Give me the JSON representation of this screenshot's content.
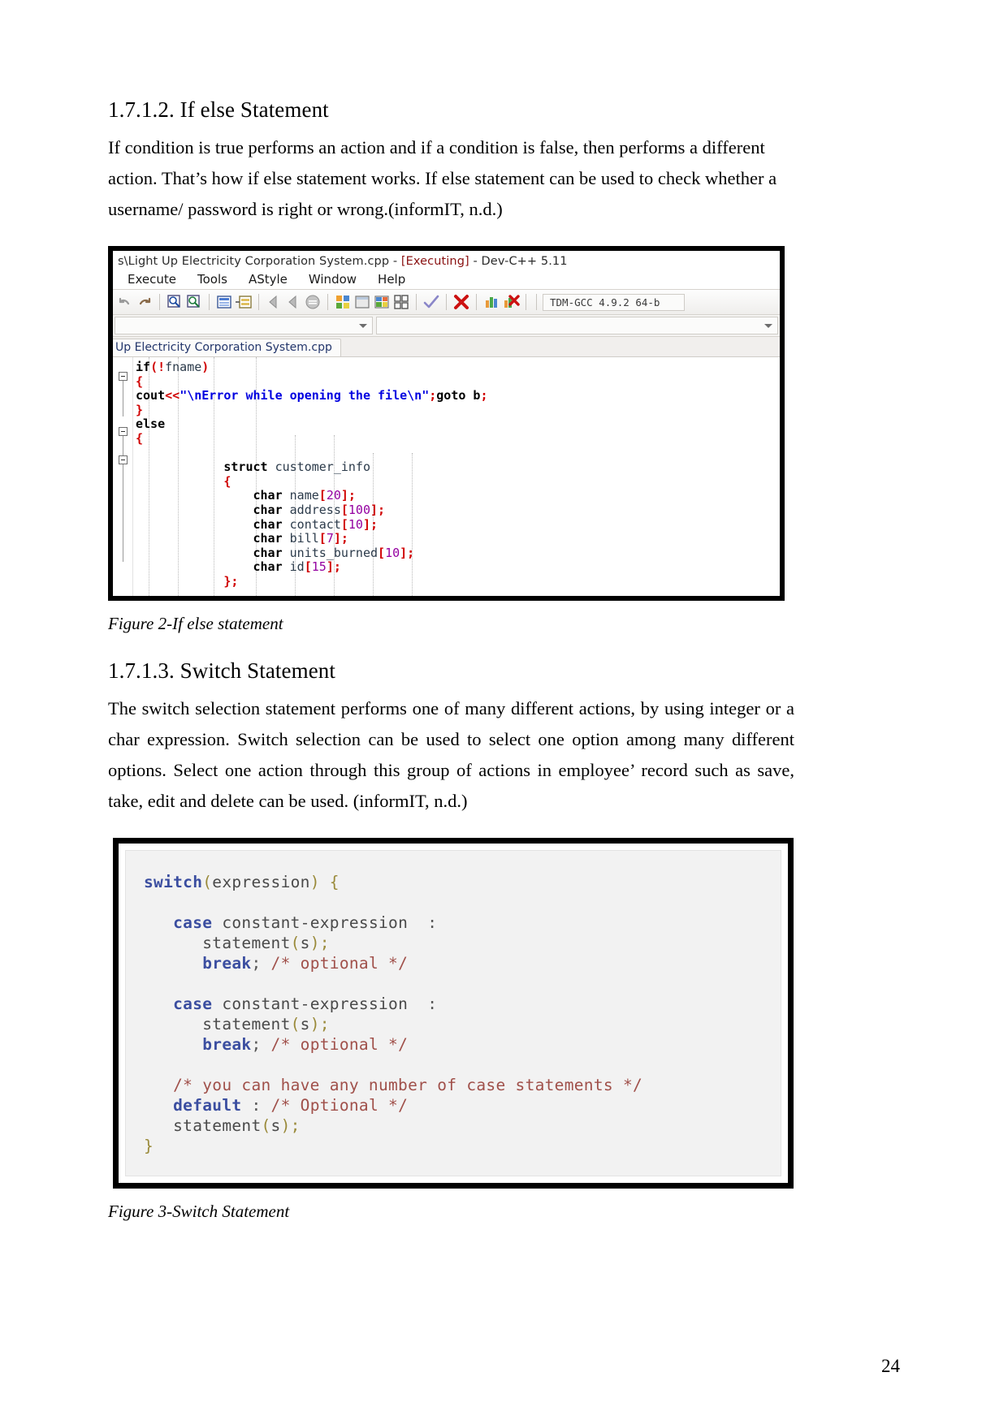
{
  "document": {
    "page_number": "24",
    "sections": [
      {
        "heading": "1.7.1.2. If else Statement",
        "paragraph": "If condition is true performs an action and if a condition is false, then performs a different action. That’s how if else statement works. If else statement can be used to check whether a username/ password is right or wrong.(informIT, n.d.)",
        "caption": "Figure 2-If else statement"
      },
      {
        "heading": "1.7.1.3. Switch Statement",
        "paragraph": "The switch selection statement performs one of many different actions, by using integer or a char expression. Switch selection can be used to select one option among many different options. Select one action through this group of actions in employee’ record such as save, take, edit and delete can be used. (informIT, n.d.)",
        "caption": "Figure 3-Switch Statement"
      }
    ]
  },
  "figure2": {
    "title": "s\\Light Up Electricity Corporation System.cpp - [Executing] - Dev-C++ 5.11",
    "title_plain": "s\\Light Up Electricity Corporation System.cpp - ",
    "title_exec": "[Executing]",
    "title_tail": " - Dev-C++ 5.11",
    "menu": [
      "Execute",
      "Tools",
      "AStyle",
      "Window",
      "Help"
    ],
    "compiler_combo": "TDM-GCC  4.9.2  64-b",
    "tab_label": "Up Electricity Corporation System.cpp",
    "code_lines": [
      "if(!fname)",
      "{",
      "cout<<\"\\nError while opening the file\\n\";goto b;",
      "}",
      "else",
      "{",
      "            struct customer_info",
      "            {",
      "                char name[20];",
      "                char address[100];",
      "                char contact[10];",
      "                char bill[7];",
      "                char units_burned[10];",
      "                char id[15];",
      "            };"
    ]
  },
  "figure3": {
    "code_lines": [
      "switch(expression) {",
      "",
      "   case constant-expression  :",
      "      statement(s);",
      "      break; /* optional */",
      "",
      "   case constant-expression  :",
      "      statement(s);",
      "      break; /* optional */",
      "",
      "   /* you can have any number of case statements */",
      "   default : /* Optional */",
      "   statement(s);",
      "}"
    ]
  }
}
